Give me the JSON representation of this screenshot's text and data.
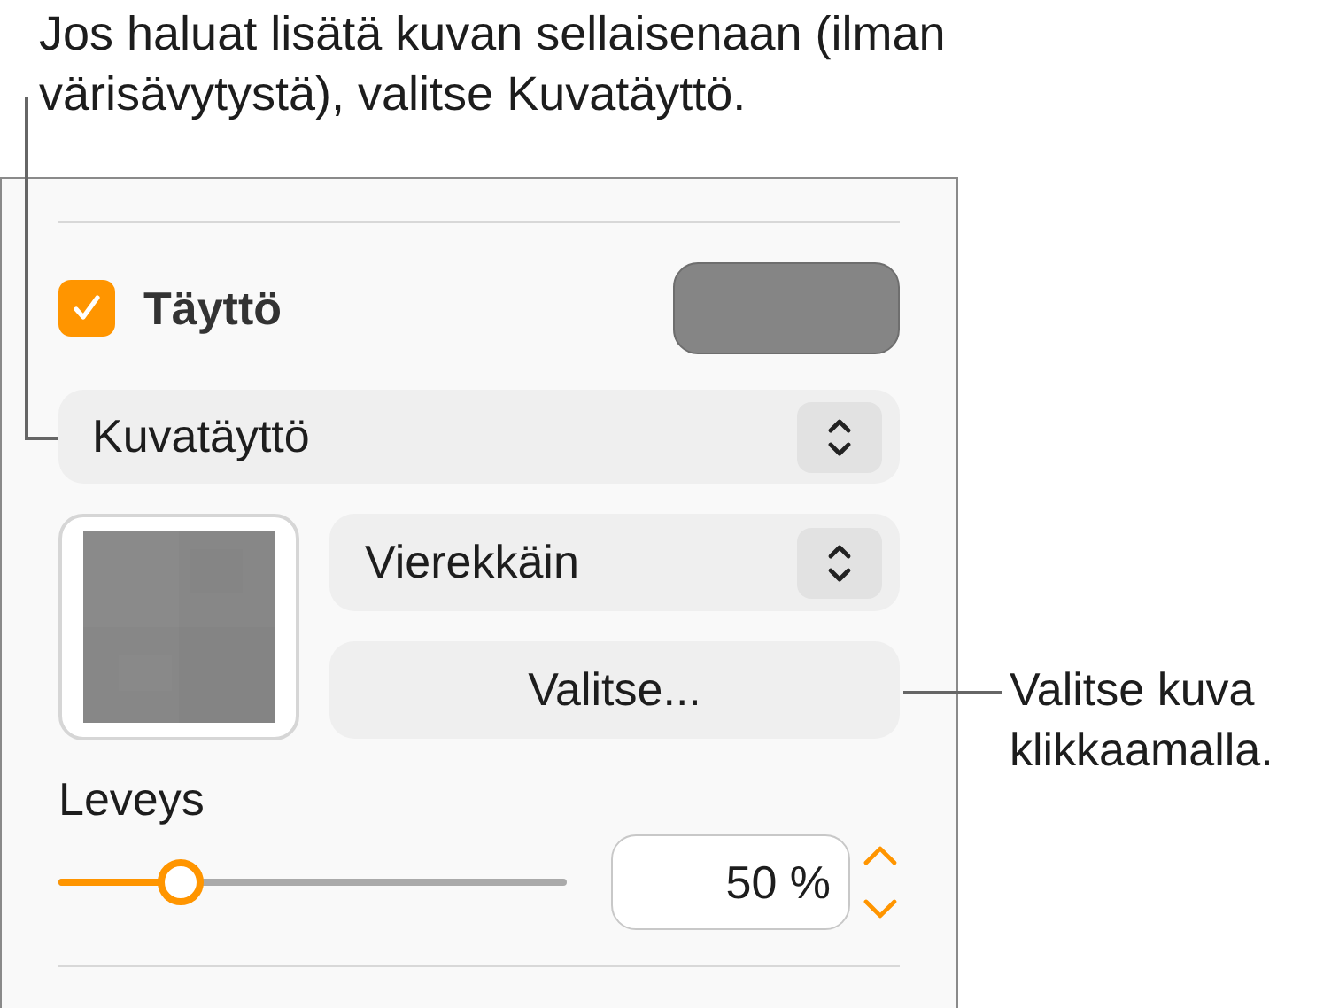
{
  "callouts": [
    {
      "text": "Jos haluat lisätä kuvan sellaisenaan (ilman värisävytystä), valitse Kuvatäyttö."
    },
    {
      "text": "Valitse kuva klikkaamalla."
    }
  ],
  "fill": {
    "label": "Täyttö",
    "checked": true
  },
  "fill_type": {
    "value": "Kuvatäyttö"
  },
  "scale": {
    "value": "Vierekkäin"
  },
  "choose_button": "Valitse...",
  "width": {
    "label": "Leveys",
    "level": 0.24,
    "value": "50 %"
  }
}
